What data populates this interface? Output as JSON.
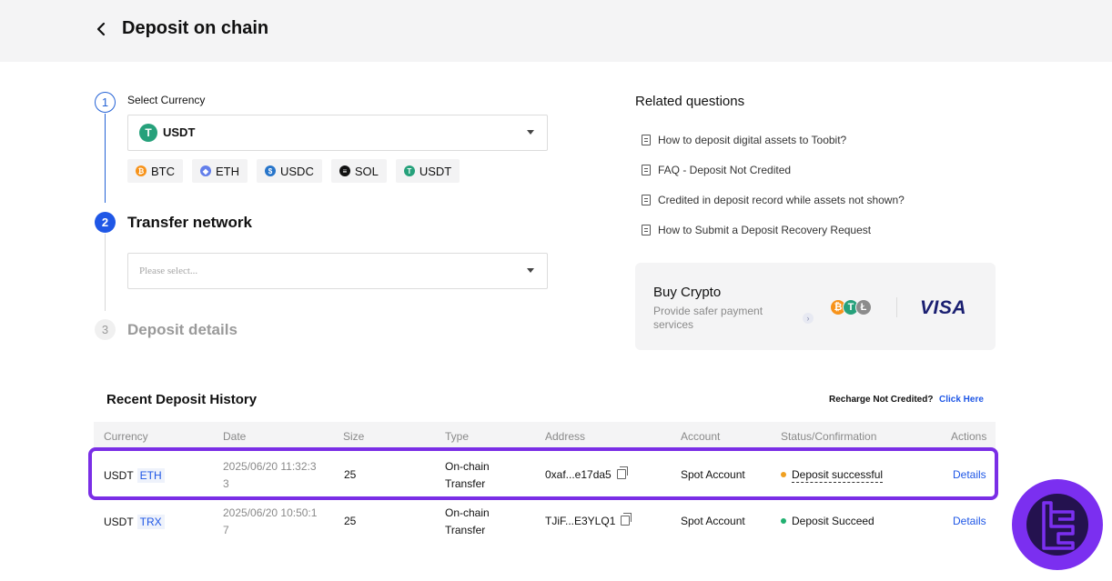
{
  "header": {
    "title": "Deposit on chain"
  },
  "steps": [
    {
      "number": "1",
      "label": "Select Currency"
    },
    {
      "number": "2",
      "label": "Transfer network"
    },
    {
      "number": "3",
      "label": "Deposit details"
    }
  ],
  "currency_select": {
    "value": "USDT",
    "icon": "tether-icon"
  },
  "quick_coins": [
    {
      "label": "BTC",
      "color": "#f7931a",
      "glyph": "₿"
    },
    {
      "label": "ETH",
      "color": "#627eea",
      "glyph": "◆"
    },
    {
      "label": "USDC",
      "color": "#2775ca",
      "glyph": "$"
    },
    {
      "label": "SOL",
      "color": "#111111",
      "glyph": "≡"
    },
    {
      "label": "USDT",
      "color": "#26a17b",
      "glyph": "T"
    }
  ],
  "network_select": {
    "placeholder": "Please select..."
  },
  "related": {
    "title": "Related questions",
    "items": [
      "How to deposit digital assets to Toobit?",
      "FAQ - Deposit Not Credited",
      "Credited in deposit record while assets not shown?",
      "How to Submit a Deposit Recovery Request"
    ]
  },
  "buy_crypto": {
    "title": "Buy Crypto",
    "subtitle": "Provide safer payment services",
    "arrow": "›",
    "brand": "VISA",
    "coins": [
      {
        "glyph": "₿",
        "color": "#f7931a"
      },
      {
        "glyph": "T",
        "color": "#26a17b"
      },
      {
        "glyph": "Ł",
        "color": "#8c8c8c"
      }
    ]
  },
  "history": {
    "title": "Recent Deposit History",
    "recharge_text": "Recharge Not Credited?",
    "click_here": "Click Here",
    "columns": [
      "Currency",
      "Date",
      "Size",
      "Type",
      "Address",
      "Account",
      "Status/Confirmation",
      "Actions"
    ],
    "rows": [
      {
        "currency": "USDT",
        "network": "ETH",
        "date_line1": "2025/06/20 11:32:3",
        "date_line2": "3",
        "size": "25",
        "type_line1": "On-chain",
        "type_line2": "Transfer",
        "address": "0xaf...e17da5",
        "account": "Spot Account",
        "status": "Deposit successful",
        "status_color": "#f0a020",
        "action": "Details"
      },
      {
        "currency": "USDT",
        "network": "TRX",
        "date_line1": "2025/06/20 10:50:1",
        "date_line2": "7",
        "size": "25",
        "type_line1": "On-chain",
        "type_line2": "Transfer",
        "address": "TJiF...E3YLQ1",
        "account": "Spot Account",
        "status": "Deposit Succeed",
        "status_color": "#20b070",
        "action": "Details"
      }
    ]
  },
  "colors": {
    "accent": "#1f57e6",
    "highlight": "#7a2ee6"
  }
}
